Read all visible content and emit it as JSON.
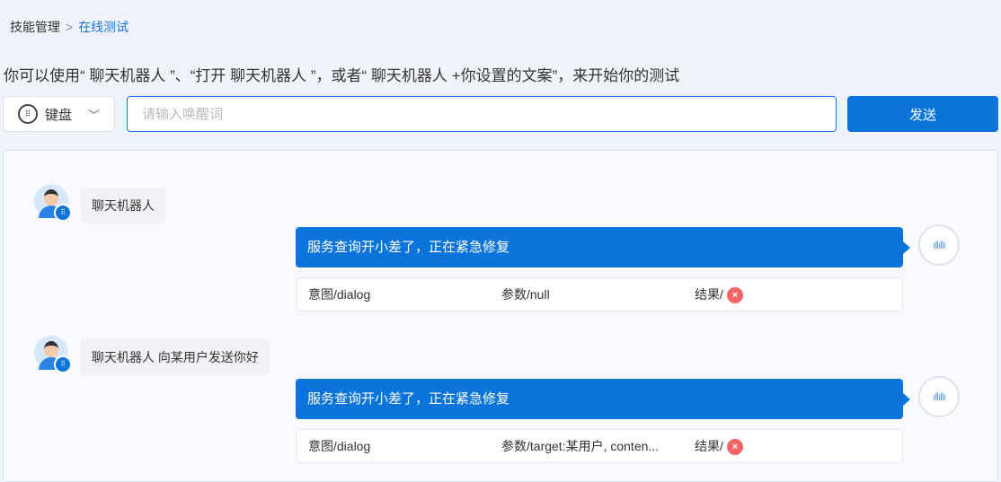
{
  "breadcrumb": {
    "parent": "技能管理",
    "current": "在线测试"
  },
  "hint": "你可以使用“ 聊天机器人 ”、“打开 聊天机器人 ”，或者“ 聊天机器人 +你设置的文案”，来开始你的测试",
  "input_mode": {
    "selected": "键盘"
  },
  "wake_input": {
    "value": "",
    "placeholder": "请输入唤醒词"
  },
  "send_label": "发送",
  "messages": [
    {
      "user": "聊天机器人",
      "reply": "服务查询开小差了，正在紧急修复",
      "intent": "意图/dialog",
      "params": "参数/null",
      "result": "结果/"
    },
    {
      "user": "聊天机器人 向某用户发送你好",
      "reply": "服务查询开小差了，正在紧急修复",
      "intent": "意图/dialog",
      "params": "参数/target:某用户, conten...",
      "result": "结果/"
    }
  ]
}
